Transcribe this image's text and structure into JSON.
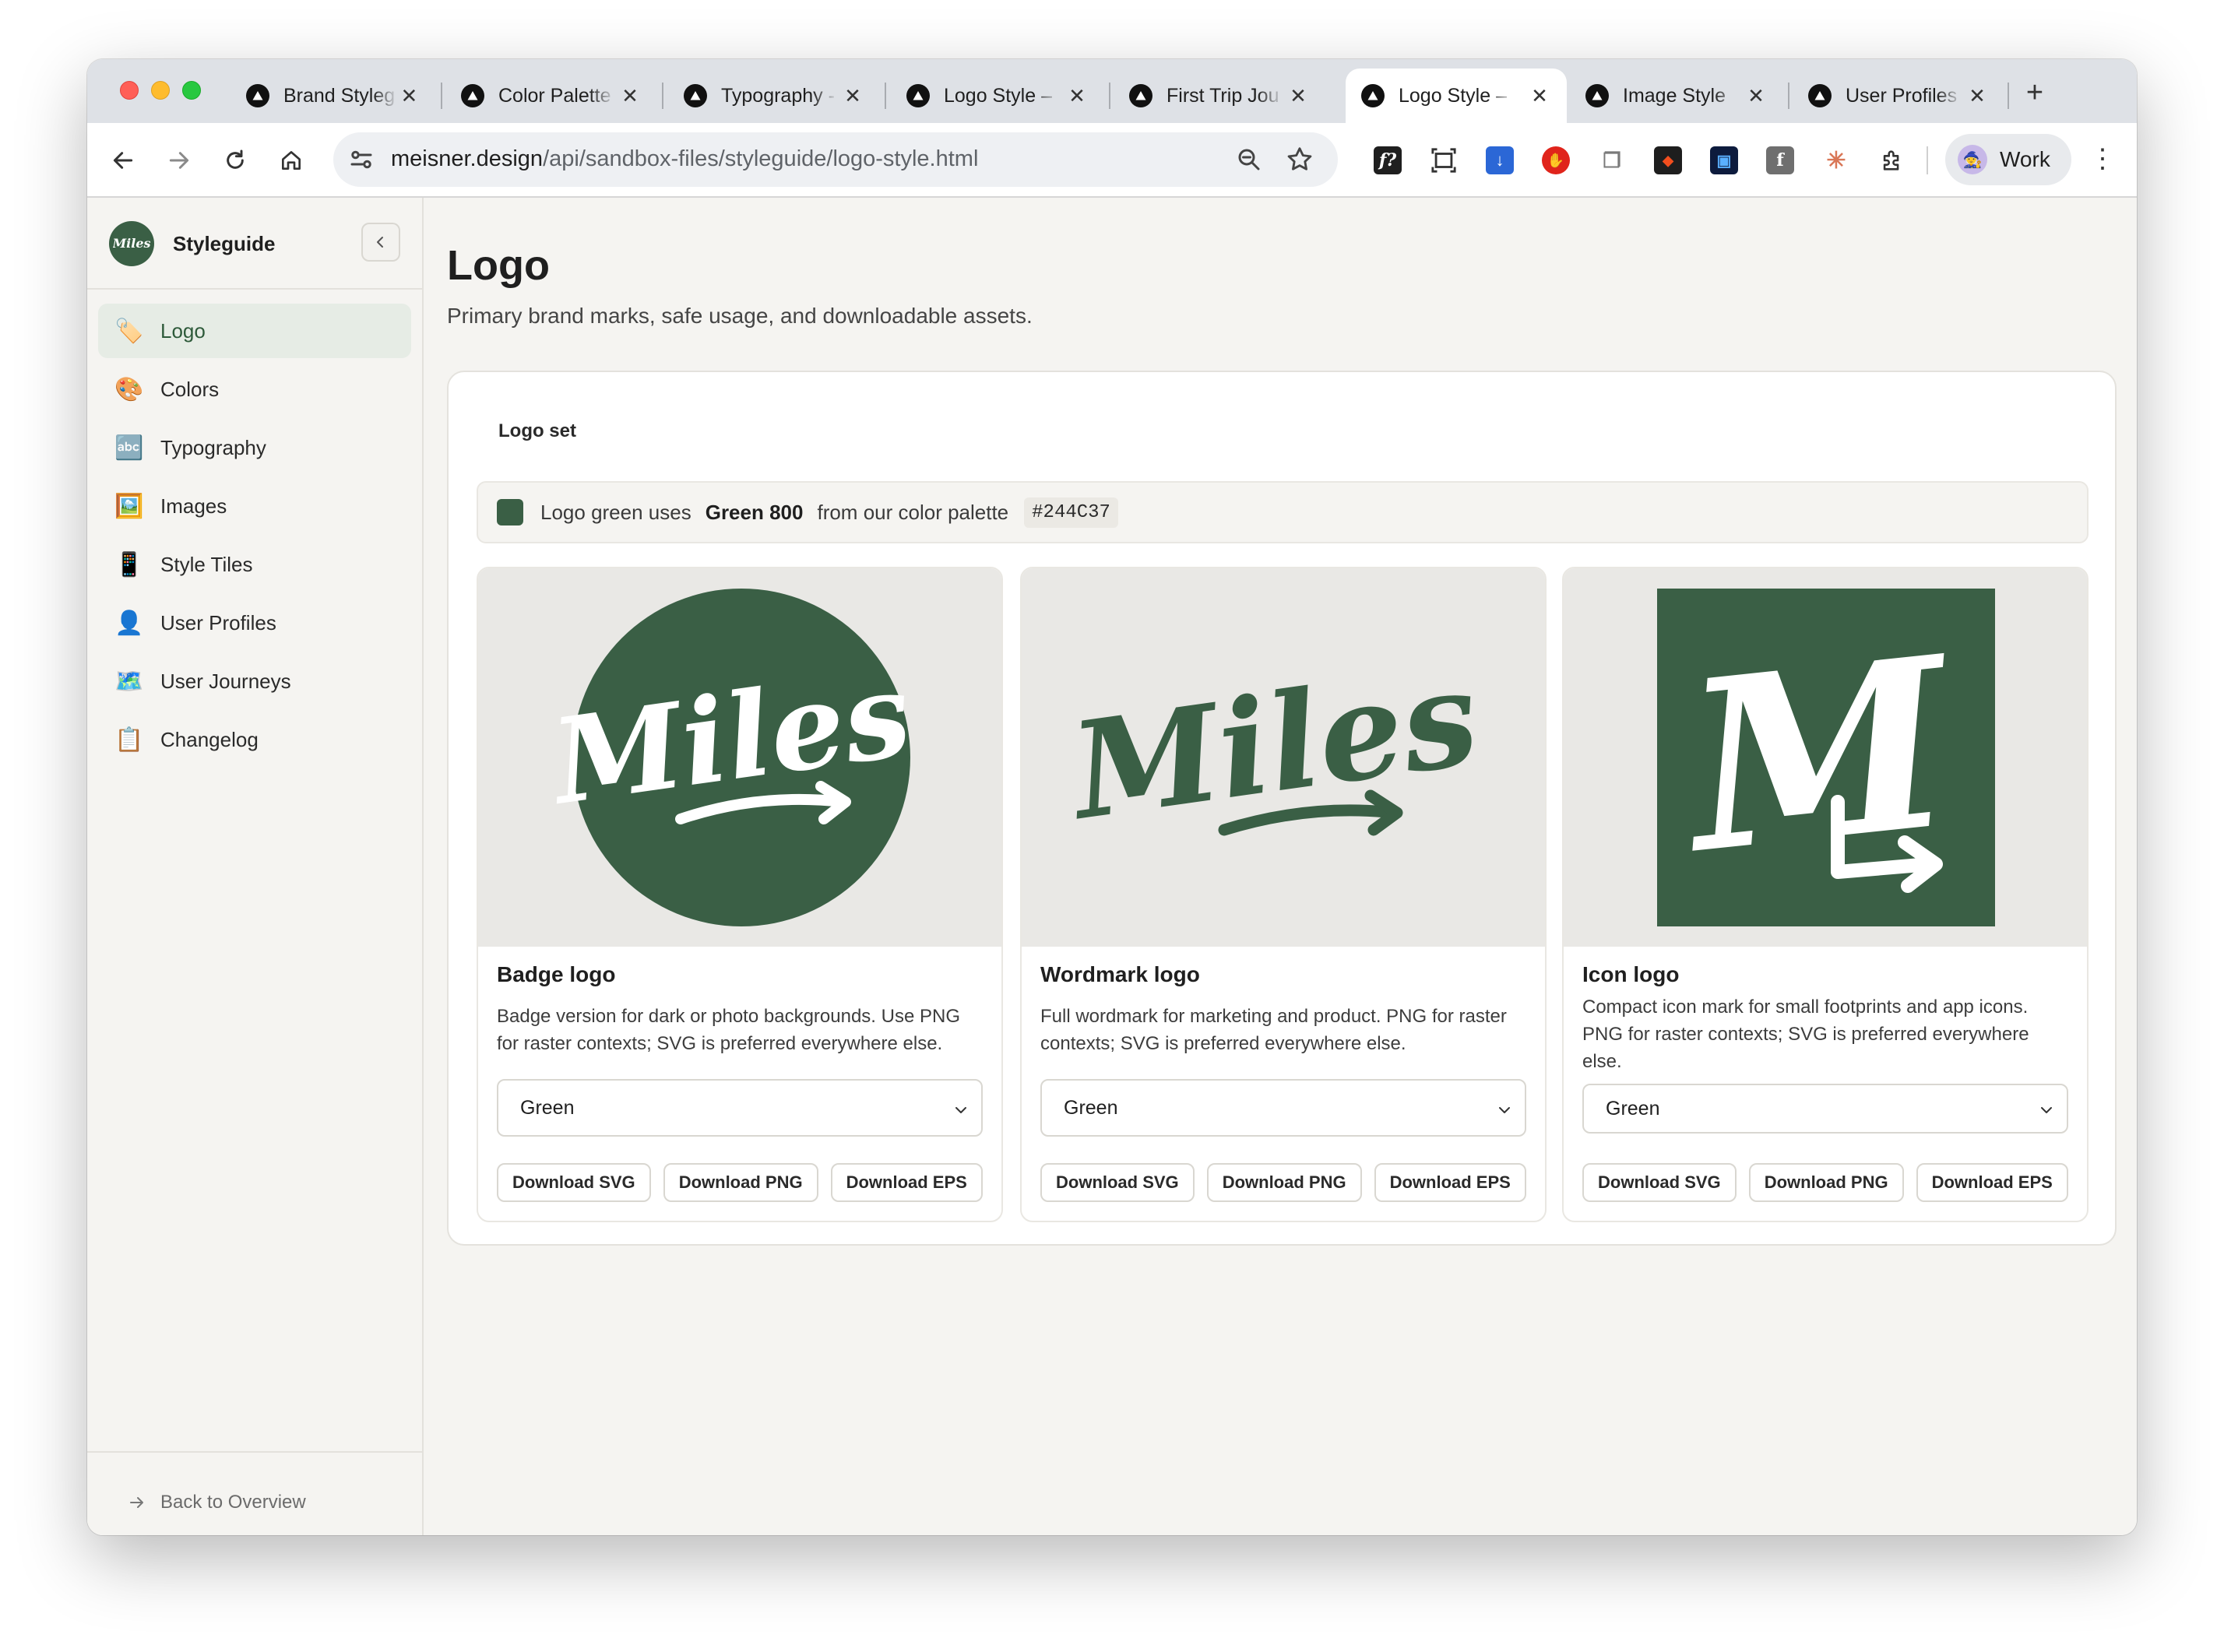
{
  "browser": {
    "tabs": [
      {
        "title": "Brand Styleg",
        "active": false
      },
      {
        "title": "Color Palette",
        "active": false
      },
      {
        "title": "Typography -",
        "active": false
      },
      {
        "title": "Logo Style –",
        "active": false
      },
      {
        "title": "First Trip Jou",
        "active": false
      },
      {
        "title": "Logo Style –",
        "active": true
      },
      {
        "title": "Image Style",
        "active": false
      },
      {
        "title": "User Profiles",
        "active": false
      }
    ],
    "close_glyph": "✕",
    "new_tab_glyph": "+",
    "url_host": "meisner.design",
    "url_path": "/api/sandbox-files/styleguide/logo-style.html",
    "profile_label": "Work",
    "kebab_glyph": "⋮",
    "extensions": [
      {
        "icon": "fx-icon",
        "glyph": "f?",
        "color": "#1f1f1f"
      },
      {
        "icon": "screenshot-icon",
        "glyph": "",
        "color": "#ffffff"
      },
      {
        "icon": "download-ext-icon",
        "glyph": "↓",
        "color": "#2b67d6"
      },
      {
        "icon": "adblock-icon",
        "glyph": "✋",
        "color": "#e0241b"
      },
      {
        "icon": "copy-ext-icon",
        "glyph": "❐",
        "color": "#7a7a7a"
      },
      {
        "icon": "figma-icon",
        "glyph": "◆",
        "color": "#1e1e1e"
      },
      {
        "icon": "scan-ext-icon",
        "glyph": "▣",
        "color": "#0d1b3d"
      },
      {
        "icon": "font-ext-icon",
        "glyph": "f",
        "color": "#6f6f6f"
      },
      {
        "icon": "claude-icon",
        "glyph": "✳",
        "color": "#ffffff"
      },
      {
        "icon": "puzzle-icon",
        "glyph": "",
        "color": "#ffffff"
      }
    ]
  },
  "sidebar": {
    "brand_name": "Styleguide",
    "items": [
      {
        "label": "Logo",
        "icon": "🏷️",
        "active": true
      },
      {
        "label": "Colors",
        "icon": "🎨",
        "active": false
      },
      {
        "label": "Typography",
        "icon": "🔤",
        "active": false
      },
      {
        "label": "Images",
        "icon": "🖼️",
        "active": false
      },
      {
        "label": "Style Tiles",
        "icon": "📱",
        "active": false
      },
      {
        "label": "User Profiles",
        "icon": "👤",
        "active": false
      },
      {
        "label": "User Journeys",
        "icon": "🗺️",
        "active": false
      },
      {
        "label": "Changelog",
        "icon": "📋",
        "active": false
      }
    ],
    "back_label": "Back to Overview"
  },
  "main": {
    "title": "Logo",
    "subtitle": "Primary brand marks, safe usage, and downloadable assets.",
    "section_label": "Logo set",
    "note": {
      "prefix": "Logo green uses",
      "color_name": "Green 800",
      "suffix": "from our color palette",
      "hex": "#244C37",
      "swatch_color": "#3a5f45"
    },
    "logos": [
      {
        "title": "Badge logo",
        "wordmark": "Miles",
        "description": "Badge version for dark or photo backgrounds. Use PNG for raster contexts; SVG is preferred everywhere else.",
        "select_value": "Green",
        "buttons": [
          "Download SVG",
          "Download PNG",
          "Download EPS"
        ]
      },
      {
        "title": "Wordmark logo",
        "wordmark": "Miles",
        "description": "Full wordmark for marketing and product. PNG for raster contexts; SVG is preferred everywhere else.",
        "select_value": "Green",
        "buttons": [
          "Download SVG",
          "Download PNG",
          "Download EPS"
        ]
      },
      {
        "title": "Icon logo",
        "wordmark": "M",
        "description": "Compact icon mark for small footprints and app icons. PNG for raster contexts; SVG is preferred everywhere else.",
        "select_value": "Green",
        "buttons": [
          "Download SVG",
          "Download PNG",
          "Download EPS"
        ]
      }
    ],
    "brand_green": "#3a5f45"
  }
}
